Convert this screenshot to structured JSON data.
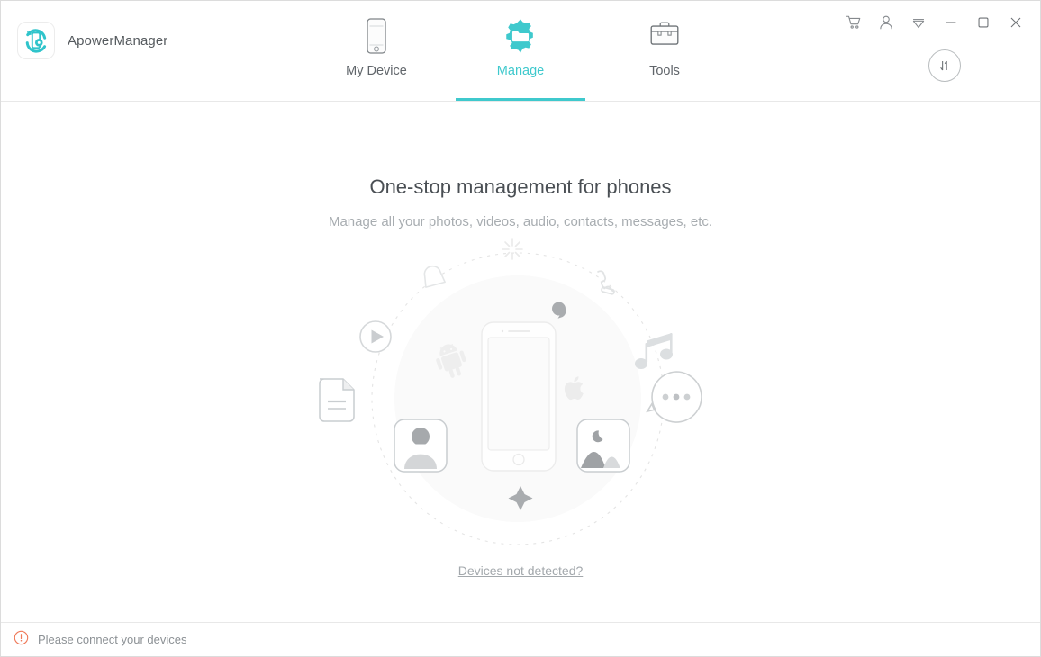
{
  "app": {
    "title": "ApowerManager",
    "logo_icon": "apowermanager-logo-icon"
  },
  "nav": {
    "tabs": [
      {
        "label": "My Device",
        "icon": "phone-icon",
        "active": false
      },
      {
        "label": "Manage",
        "icon": "gear-folder-icon",
        "active": true
      },
      {
        "label": "Tools",
        "icon": "toolbox-icon",
        "active": false
      }
    ]
  },
  "window_controls": {
    "cart": "cart-icon",
    "account": "user-icon",
    "menu": "dropdown-triangle-icon",
    "minimize": "minimize-icon",
    "maximize": "maximize-icon",
    "close": "close-icon",
    "sync": "transfer-arrows-icon"
  },
  "main": {
    "headline": "One-stop management for phones",
    "subline": "Manage all your photos, videos, audio, contacts, messages, etc.",
    "not_detected_link": "Devices not detected?",
    "illustration_icons": [
      "sparkle-icon",
      "diamond-icon",
      "phone-handset-icon",
      "play-circle-icon",
      "music-note-icon",
      "document-icon",
      "chat-bubble-icon",
      "contacts-icon",
      "photos-icon",
      "android-icon",
      "apple-icon",
      "message-bubble-icon",
      "star-icon",
      "device-phone-icon"
    ]
  },
  "status": {
    "icon": "warning-circle-icon",
    "message": "Please connect your devices"
  },
  "colors": {
    "accent": "#3fc9cd",
    "warning": "#ef7a5a",
    "text_primary": "#4a4f54",
    "text_muted": "#a8adb1",
    "border": "#e8e8e8"
  }
}
